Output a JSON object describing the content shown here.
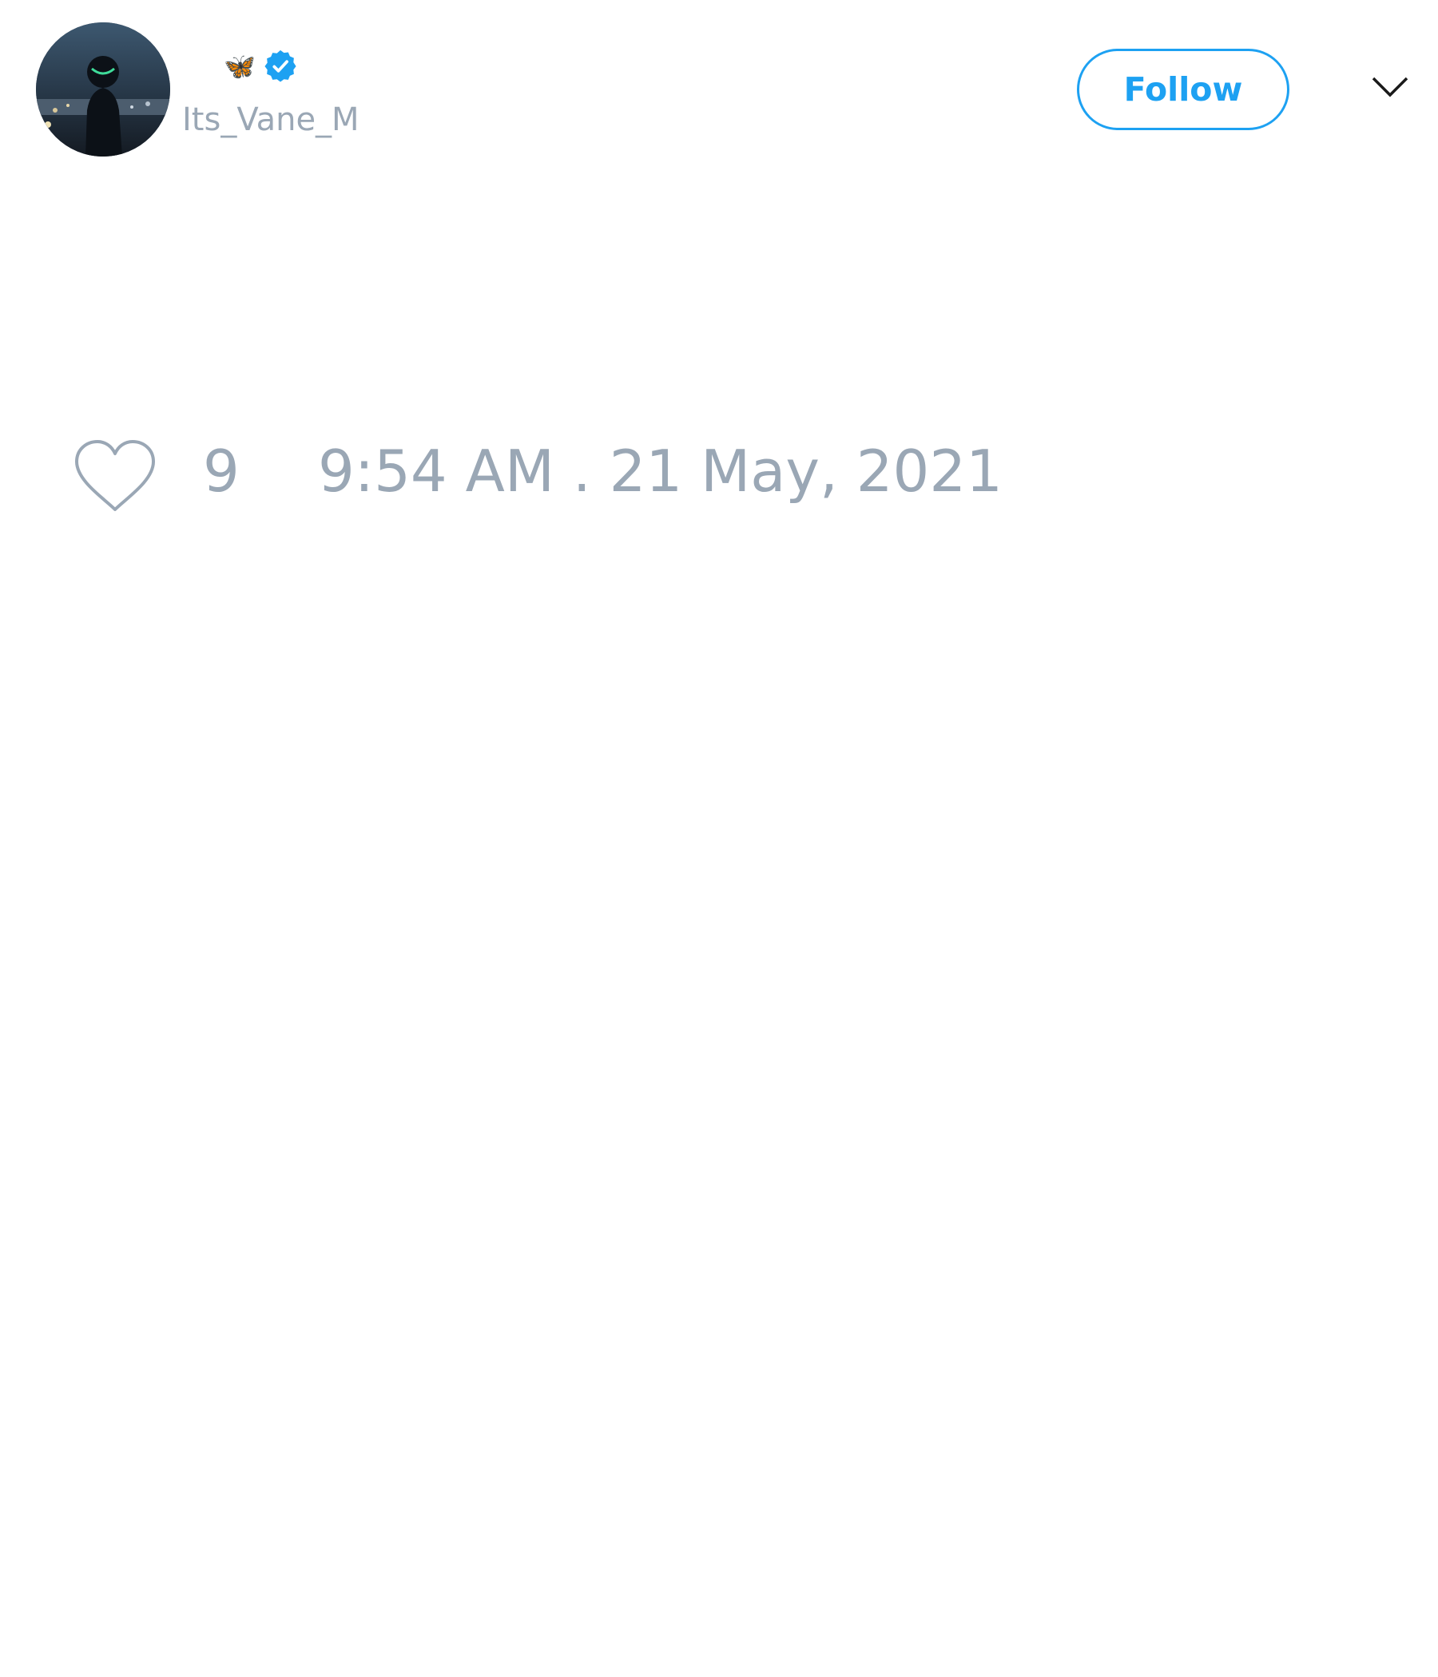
{
  "header": {
    "display_name_emoji": "🦋",
    "verified_icon": "verified-badge-icon",
    "handle": "Its_Vane_M",
    "follow_label": "Follow",
    "menu_icon": "chevron-down-icon"
  },
  "footer": {
    "like_icon": "heart-icon",
    "like_count": "9",
    "timestamp": "9:54 AM . 21 May, 2021"
  },
  "colors": {
    "accent": "#1da1f2",
    "muted_text": "#9aa7b5",
    "background": "#ffffff"
  }
}
